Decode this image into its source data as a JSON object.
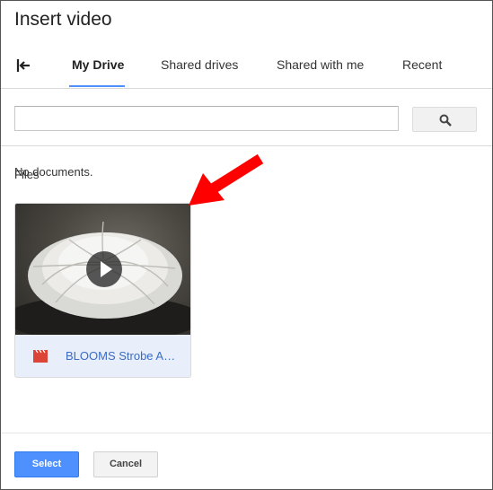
{
  "dialog": {
    "title": "Insert video"
  },
  "tabs": [
    {
      "label": "My Drive",
      "active": true
    },
    {
      "label": "Shared drives",
      "active": false
    },
    {
      "label": "Shared with me",
      "active": false
    },
    {
      "label": "Recent",
      "active": false
    }
  ],
  "icons": {
    "back": "back-arrow-icon",
    "search": "search-icon",
    "play": "play-icon",
    "file_type": "video-file-icon"
  },
  "search": {
    "value": "",
    "placeholder": ""
  },
  "content": {
    "no_documents": "No documents.",
    "files_label": "Files",
    "files": [
      {
        "name": "BLOOMS Strobe Ani..."
      }
    ]
  },
  "buttons": {
    "select": "Select",
    "cancel": "Cancel"
  },
  "colors": {
    "accent": "#4d90fe",
    "annotation_arrow": "#ff0000",
    "file_icon": "#db4437"
  }
}
